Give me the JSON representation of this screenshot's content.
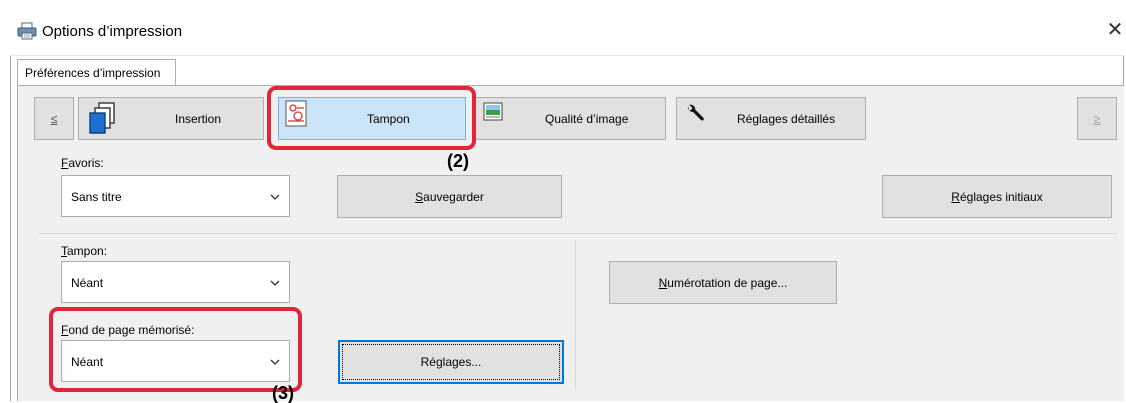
{
  "window": {
    "title": "Options d’impression",
    "close_glyph": "✕",
    "title_icon": "printer-icon"
  },
  "tabs": [
    {
      "label": "Préférences d’impression",
      "selected": true
    }
  ],
  "nav": {
    "prev_glyph": "≤",
    "next_glyph": "≥",
    "items": [
      {
        "label": "Insertion",
        "icon": "insertion-pages-icon",
        "selected": false
      },
      {
        "label": "Tampon",
        "icon": "stamp-icon",
        "selected": true
      },
      {
        "label": "Qualité d’image",
        "icon": "image-quality-icon",
        "selected": false
      },
      {
        "label": "Réglages détaillés",
        "icon": "wrench-icon",
        "selected": false
      }
    ]
  },
  "favorites": {
    "label_hotkey": "F",
    "label_rest": "avoris:",
    "value": "Sans titre",
    "save_hotkey": "S",
    "save_rest": "auvegarder",
    "initial_hotkey": "R",
    "initial_rest": "églages initiaux"
  },
  "stamp": {
    "label_hotkey": "T",
    "label_rest": "ampon:",
    "value": "Néant"
  },
  "page_numbering": {
    "hotkey": "N",
    "rest": "umérotation de page..."
  },
  "background": {
    "label_hotkey": "F",
    "label_rest": "ond de page mémorisé:",
    "value": "Néant",
    "settings_before": "Ré",
    "settings_hotkey": "g",
    "settings_after": "lages..."
  },
  "annotations": {
    "callout_2": "(2)",
    "callout_3": "(3)",
    "highlight_color": "#e0263a"
  },
  "colors": {
    "selected_tab_fill": "#cce4f7",
    "panel_background": "#f0f0f0",
    "button_face": "#e1e1e1",
    "focus_blue": "#0078d7"
  }
}
